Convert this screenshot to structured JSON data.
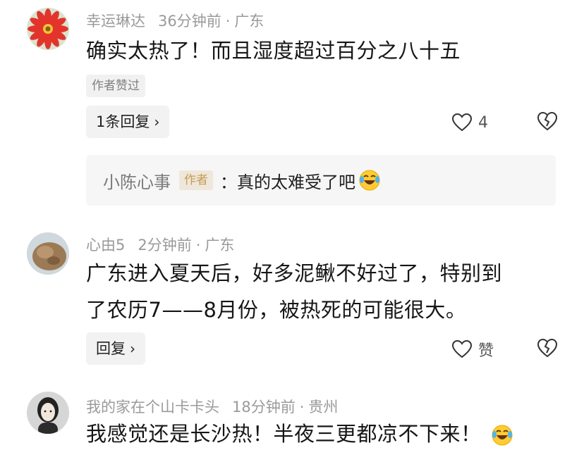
{
  "comments": [
    {
      "username": "幸运琳达",
      "time": "36分钟前",
      "location": "广东",
      "text": "确实太热了！而且湿度超过百分之八十五",
      "badge": "作者赞过",
      "reply_button": "1条回复",
      "like_count": "4",
      "reply_preview": {
        "name": "小陈心事",
        "tag": "作者",
        "content": "：真的太难受了吧"
      }
    },
    {
      "username": "心由5",
      "time": "2分钟前",
      "location": "广东",
      "text_line1": "广东进入夏天后，好多泥鳅不好过了，特别到",
      "text_line2": "了农历7——8月份，被热死的可能很大。",
      "reply_button": "回复",
      "like_label": "赞"
    },
    {
      "username": "我的家在个山卡卡头",
      "time": "18分钟前",
      "location": "贵州",
      "text": "我感觉还是长沙热！半夜三更都凉不下来！"
    }
  ],
  "chevron": "›",
  "separator": "·",
  "icons": {
    "like": "heart-outline-icon",
    "dislike": "broken-heart-icon",
    "emoji": "crying-laughing-emoji"
  }
}
